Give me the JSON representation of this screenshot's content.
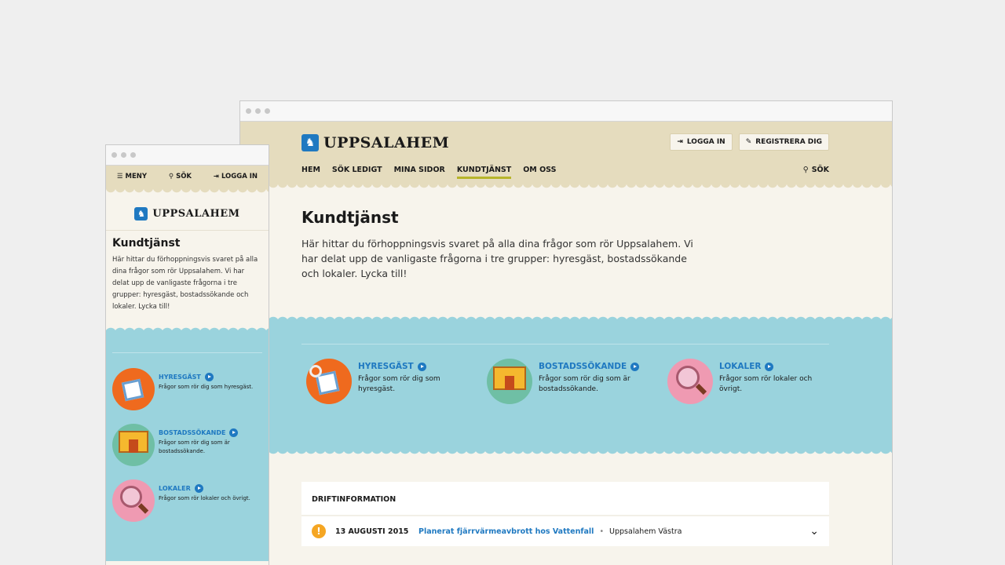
{
  "brand": {
    "name": "UPPSALAHEM"
  },
  "desktop": {
    "buttons": {
      "login": "LOGGA IN",
      "register": "REGISTRERA DIG"
    },
    "nav": [
      {
        "label": "HEM",
        "active": false
      },
      {
        "label": "SÖK LEDIGT",
        "active": false
      },
      {
        "label": "MINA SIDOR",
        "active": false
      },
      {
        "label": "KUNDTJÄNST",
        "active": true
      },
      {
        "label": "OM OSS",
        "active": false
      }
    ],
    "search_label": "SÖK",
    "page_title": "Kundtjänst",
    "intro": "Här hittar du förhoppningsvis svaret på alla dina frågor som rör Uppsalahem. Vi har delat upp de vanligaste frågorna i tre grupper: hyresgäst, bostadssökande och lokaler. Lycka till!",
    "categories": [
      {
        "title": "HYRESGÄST",
        "desc": "Frågor som rör dig som hyresgäst.",
        "icon": "keys-icon"
      },
      {
        "title": "BOSTADSSÖKANDE",
        "desc": "Frågor som rör dig som är bostadssökande.",
        "icon": "house-icon"
      },
      {
        "title": "LOKALER",
        "desc": "Frågor som rör lokaler och övrigt.",
        "icon": "magnifier-icon"
      }
    ],
    "drift": {
      "heading": "DRIFTINFORMATION",
      "items": [
        {
          "date": "13 AUGUSTI 2015",
          "title": "Planerat fjärrvärmeavbrott hos Vattenfall",
          "area": "Uppsalahem Västra"
        }
      ]
    }
  },
  "mobile": {
    "menu_label": "MENY",
    "search_label": "SÖK",
    "login_label": "LOGGA IN",
    "page_title": "Kundtjänst",
    "intro": "Här hittar du förhoppningsvis svaret på alla dina frågor som rör Uppsalahem. Vi har delat upp de vanligaste frågorna i tre grupper: hyresgäst, bostadssökande och lokaler. Lycka till!",
    "categories": [
      {
        "title": "HYRESGÄST",
        "desc": "Frågor som rör dig som hyresgäst."
      },
      {
        "title": "BOSTADSSÖKANDE",
        "desc": "Frågor som rör dig som är bostadssökande."
      },
      {
        "title": "LOKALER",
        "desc": "Frågor som rör lokaler och övrigt."
      }
    ]
  },
  "colors": {
    "header_bg": "#e5dcbe",
    "page_bg": "#f7f4ec",
    "teal": "#9ad3dd",
    "link_blue": "#1f79c1",
    "nav_underline": "#b7b52a",
    "alert_orange": "#f5a623"
  }
}
